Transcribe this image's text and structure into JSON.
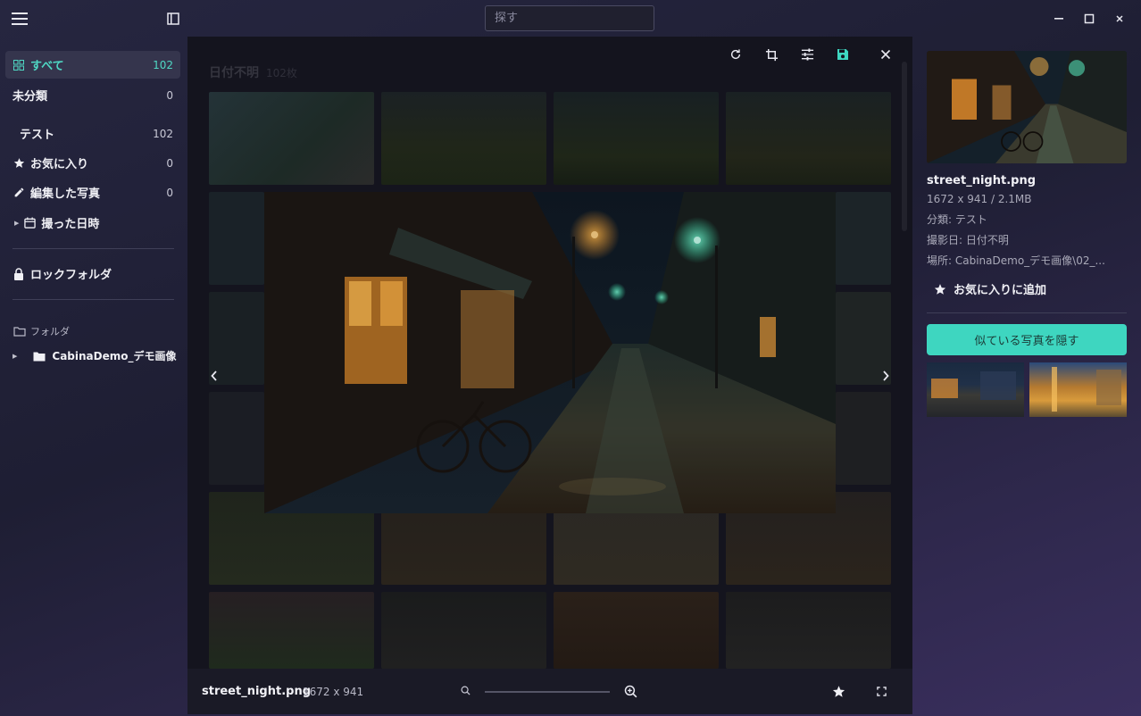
{
  "search": {
    "placeholder": "探す"
  },
  "sidebar": {
    "items": [
      {
        "label": "すべて",
        "count": "102",
        "icon": "grid-icon"
      },
      {
        "label": "未分類",
        "count": "0",
        "icon": ""
      },
      {
        "label": "テスト",
        "count": "102",
        "icon": ""
      },
      {
        "label": "お気に入り",
        "count": "0",
        "icon": "star-icon"
      },
      {
        "label": "編集した写真",
        "count": "0",
        "icon": "pencil-icon"
      },
      {
        "label": "撮った日時",
        "count": "",
        "icon": "calendar-icon"
      },
      {
        "label": "ロックフォルダ",
        "count": "",
        "icon": "lock-icon"
      }
    ],
    "folders_heading": "フォルダ",
    "folder_item": "CabinaDemo_デモ画像"
  },
  "grid": {
    "title": "日付不明",
    "count": "102枚"
  },
  "viewer": {
    "file_name": "street_night.png",
    "dimensions": "1672 x 941",
    "zoom_percent": 0
  },
  "info": {
    "file_name": "street_night.png",
    "size_line": "1672 x 941 / 2.1MB",
    "category_line": "分類: テスト",
    "date_line": "撮影日: 日付不明",
    "location_line": "場所: CabinaDemo_デモ画像\\02_...",
    "favorite_label": "お気に入りに追加",
    "hide_similar_label": "似ている写真を隠す"
  },
  "colors": {
    "accent": "#3ed6c0",
    "active_text": "#4fd8c4",
    "bg": "#1e1e33"
  }
}
